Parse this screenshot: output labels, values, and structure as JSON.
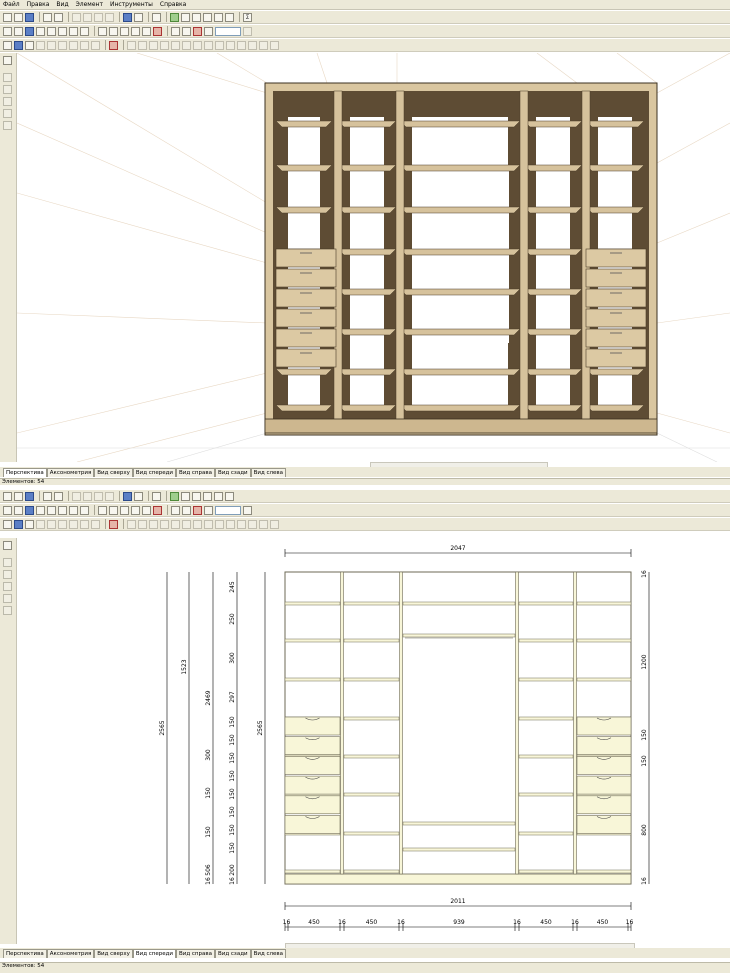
{
  "menu": [
    "Файл",
    "Правка",
    "Вид",
    "Элемент",
    "Инструменты",
    "Справка"
  ],
  "view_tabs": [
    "Перспектива",
    "Аксонометрия",
    "Вид сверху",
    "Вид спереди",
    "Вид справа",
    "Вид сзади",
    "Вид слева"
  ],
  "top_window": {
    "active_tab": "Перспектива",
    "status": "Элементов: 54"
  },
  "bottom_window": {
    "active_tab": "Вид спереди",
    "status": "Элементов: 54"
  },
  "toolbar": {
    "sum_symbol": "Σ",
    "zoom_value": ""
  },
  "dimensions": {
    "top_width": "2047",
    "bottom_width": "2011",
    "sections": [
      "16",
      "450",
      "16",
      "450",
      "16",
      "939",
      "16",
      "450",
      "16",
      "450",
      "16"
    ],
    "left_total_outer": "2565",
    "left_total": "2469",
    "left_upper": "1523",
    "left_chain_a": [
      "300",
      "150",
      "150",
      "506",
      "16"
    ],
    "left_chain_b": [
      "245",
      "250",
      "300",
      "297",
      "150",
      "150",
      "150",
      "150",
      "150",
      "150",
      "150",
      "150",
      "200",
      "16"
    ],
    "right_total": "2565",
    "right_chain": [
      "1200",
      "150",
      "150",
      "800",
      "16"
    ],
    "top_small": "16"
  },
  "colors": {
    "wood": "#d6c29c",
    "wood_dark": "#5b4a32",
    "drawer_fill": "#f8f6d8",
    "panel_line": "#6e6a55",
    "dim_line": "#000000",
    "ui": "#ece9d8"
  }
}
